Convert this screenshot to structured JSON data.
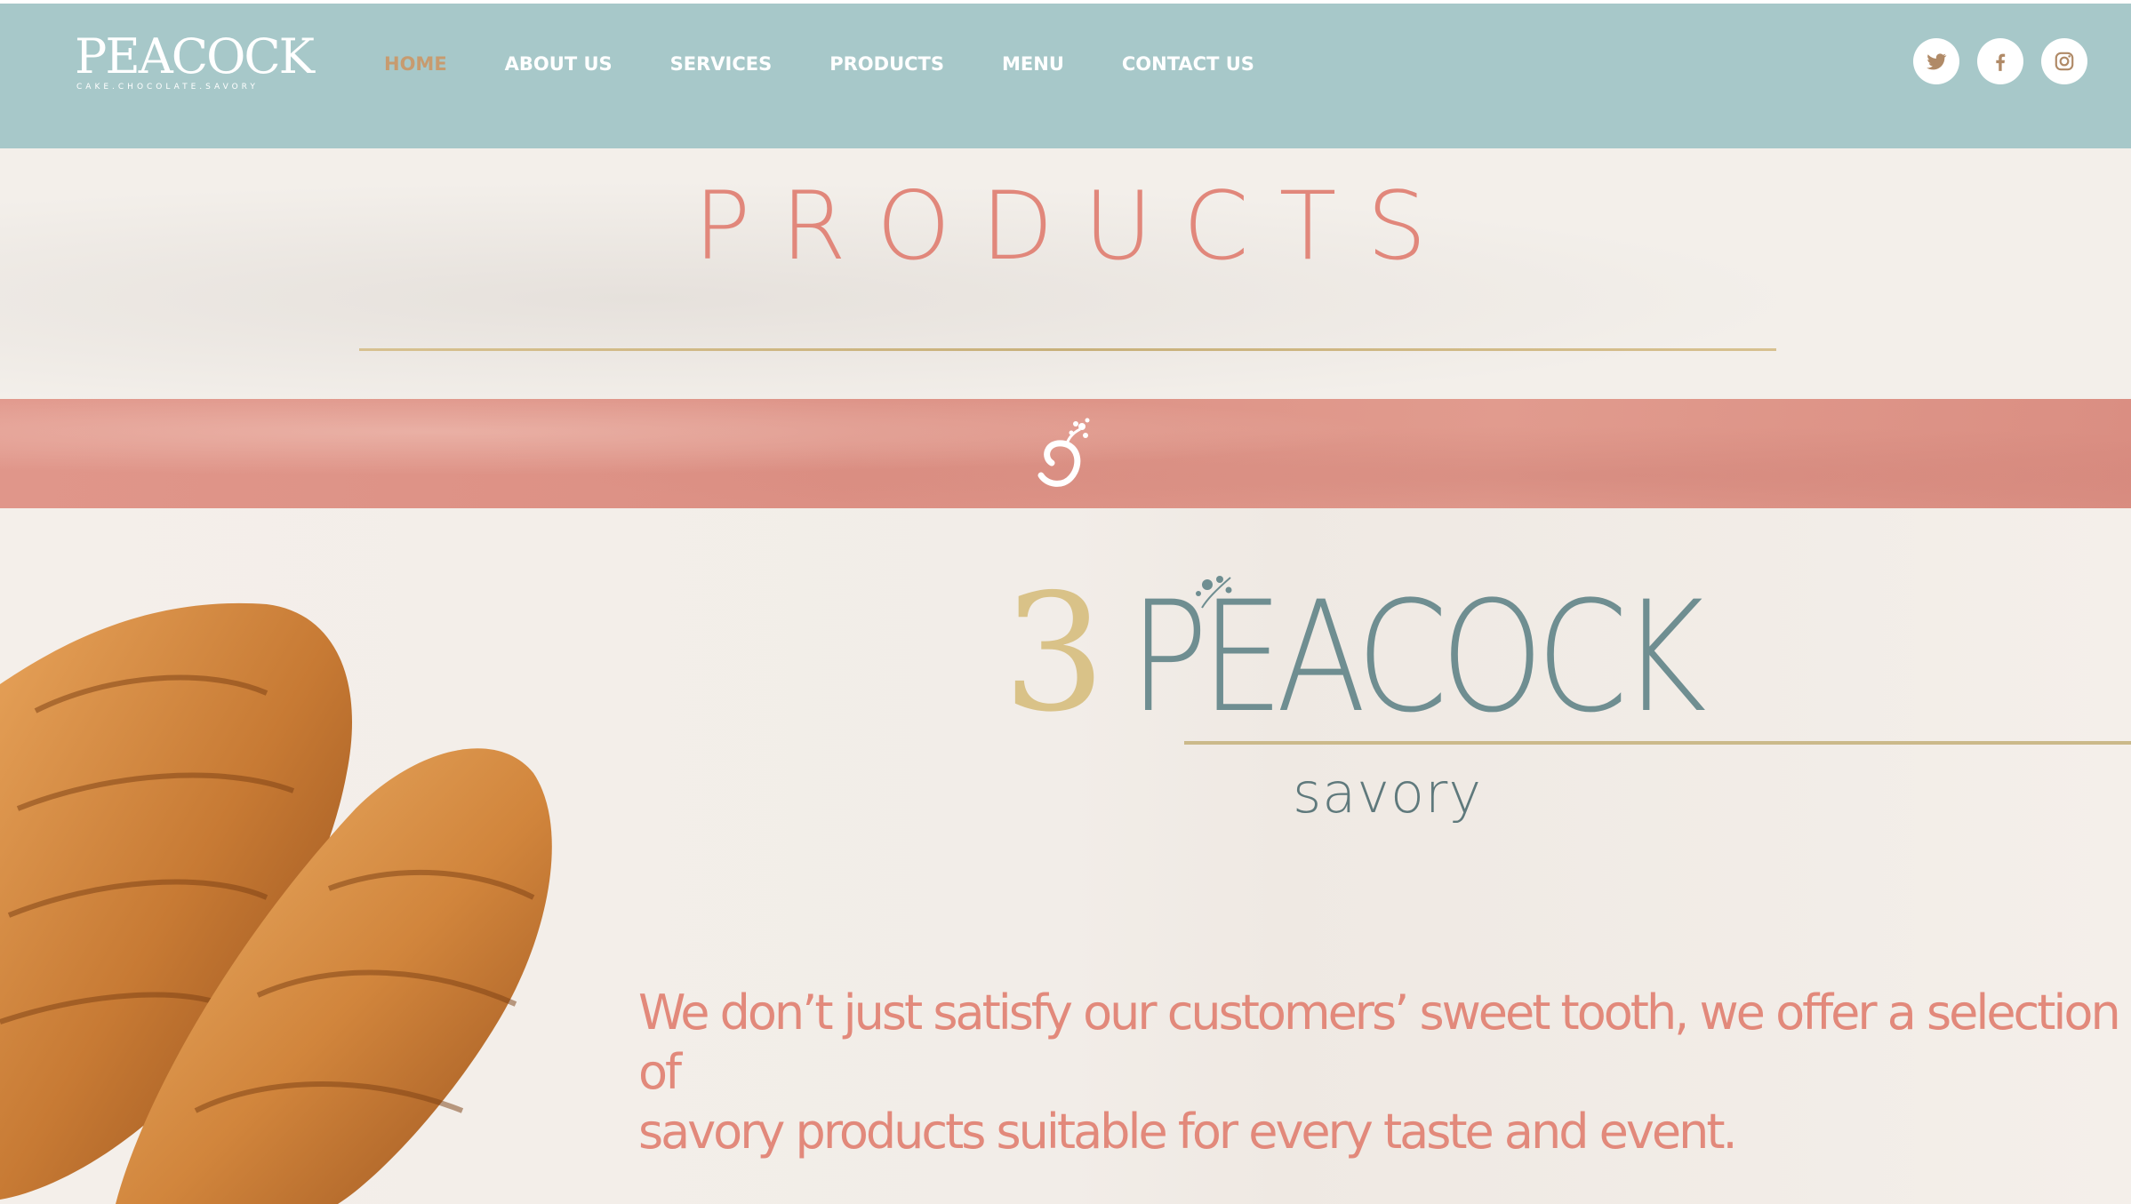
{
  "header": {
    "logo": {
      "word": "PEACOCK",
      "tagline": "CAKE.CHOCOLATE.SAVORY"
    },
    "nav": [
      {
        "label": "HOME",
        "active": true
      },
      {
        "label": "ABOUT US",
        "active": false
      },
      {
        "label": "SERVICES",
        "active": false
      },
      {
        "label": "PRODUCTS",
        "active": false
      },
      {
        "label": "MENU",
        "active": false
      },
      {
        "label": "CONTACT US",
        "active": false
      }
    ],
    "socials": [
      "twitter-icon",
      "facebook-icon",
      "instagram-icon"
    ]
  },
  "hero": {
    "title": "PRODUCTS"
  },
  "brand": {
    "number": "3",
    "word": "PEACOCK",
    "subtitle": "savory"
  },
  "intro": {
    "line1": "We don’t just satisfy our customers’ sweet tooth, we offer a selection of",
    "line2": "savory products suitable for every taste and event."
  },
  "colors": {
    "header_bg": "#a7c8c9",
    "accent_pink": "#e1877b",
    "gold": "#c8b07a",
    "teal_text": "#6f8e91",
    "nav_active": "#c79b6f"
  }
}
